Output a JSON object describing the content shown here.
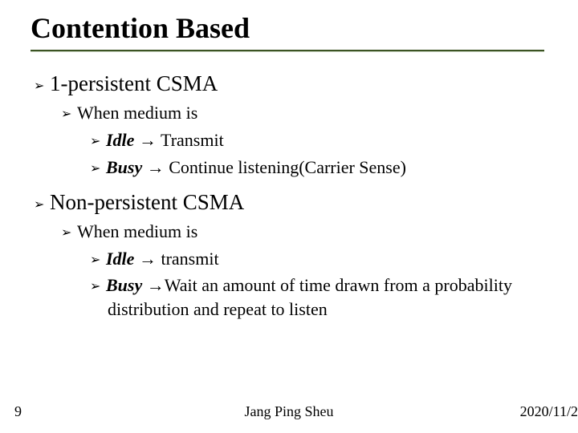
{
  "slide": {
    "title": "Contention Based",
    "footer": {
      "slide_number": "9",
      "center": "Jang Ping Sheu",
      "date": "2020/11/2"
    },
    "sections": [
      {
        "heading": "1-persistent CSMA",
        "sub_heading": "When medium is",
        "items": [
          {
            "label": "Idle",
            "text": " → Transmit"
          },
          {
            "label": "Busy",
            "text": " → Continue listening(Carrier Sense)"
          }
        ]
      },
      {
        "heading": "Non-persistent CSMA",
        "sub_heading": "When medium is",
        "items": [
          {
            "label": "Idle",
            "text": " → transmit"
          },
          {
            "label": "Busy",
            "text": " →Wait an amount of time drawn from a probability"
          }
        ],
        "continuation": "distribution and repeat to listen"
      }
    ]
  }
}
